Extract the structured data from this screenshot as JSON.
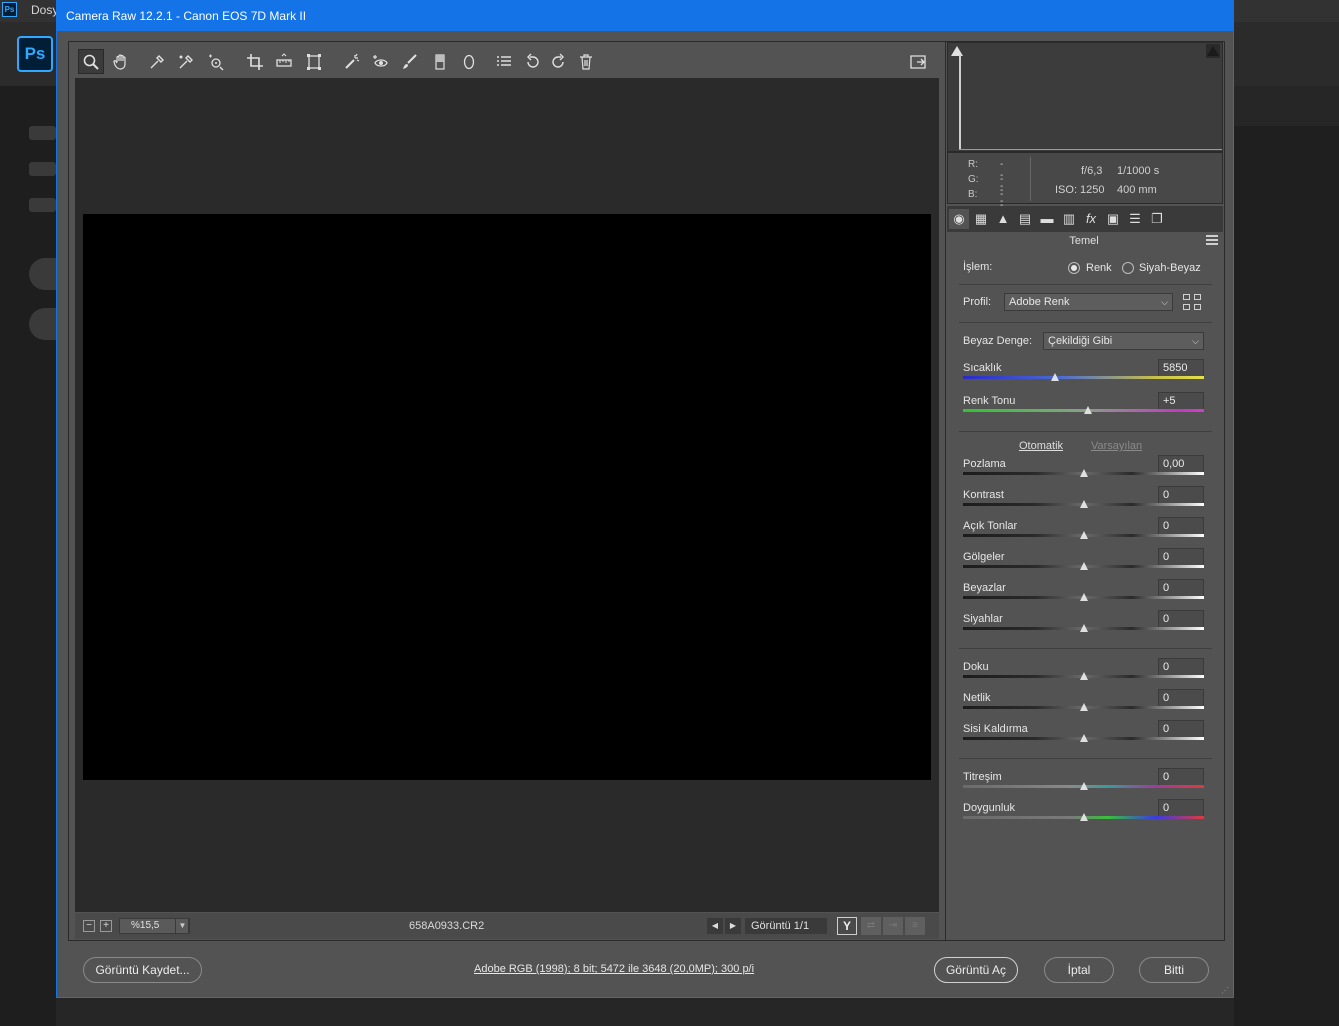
{
  "photoshop": {
    "logo_small": "Ps",
    "menu_first": "Dosy",
    "logo_big": "Ps"
  },
  "dialog": {
    "title": "Camera Raw 12.2.1  -  Canon EOS 7D Mark II"
  },
  "toolbar": {
    "tools": [
      "zoom-tool",
      "hand-tool",
      "white-balance-tool",
      "color-sampler-tool",
      "targeted-adjustment-tool",
      "crop-tool",
      "straighten-tool",
      "transform-tool",
      "spot-removal-tool",
      "red-eye-tool",
      "adjustment-brush-tool",
      "graduated-filter-tool",
      "radial-filter-tool",
      "presets-list-tool",
      "rotate-left-tool",
      "rotate-right-tool",
      "delete-tool"
    ],
    "active_tool": "zoom-tool"
  },
  "status": {
    "zoom": "%15,5",
    "filename": "658A0933.CR2",
    "view_info": "Görüntü 1/1",
    "y_button": "Y"
  },
  "info": {
    "r_label": "R:",
    "g_label": "G:",
    "b_label": "B:",
    "r_value": "---",
    "g_value": "---",
    "b_value": "---",
    "aperture": "f/6,3",
    "shutter": "1/1000 s",
    "iso": "ISO: 1250",
    "focal": "400 mm"
  },
  "panel": {
    "title": "Temel",
    "treatment_label": "İşlem:",
    "treatment_color": "Renk",
    "treatment_bw": "Siyah-Beyaz",
    "treatment_selected": "color",
    "profile_label": "Profil:",
    "profile_value": "Adobe Renk",
    "wb_label": "Beyaz Denge:",
    "wb_value": "Çekildiği Gibi",
    "auto_link": "Otomatik",
    "default_link": "Varsayılan",
    "wb_sliders": [
      {
        "label": "Sıcaklık",
        "value": "5850",
        "position": 0.38
      },
      {
        "label": "Renk Tonu",
        "value": "+5",
        "position": 0.52
      }
    ],
    "tone_sliders": [
      {
        "label": "Pozlama",
        "value": "0,00",
        "position": 0.5
      },
      {
        "label": "Kontrast",
        "value": "0",
        "position": 0.5
      },
      {
        "label": "Açık Tonlar",
        "value": "0",
        "position": 0.5
      },
      {
        "label": "Gölgeler",
        "value": "0",
        "position": 0.5
      },
      {
        "label": "Beyazlar",
        "value": "0",
        "position": 0.5
      },
      {
        "label": "Siyahlar",
        "value": "0",
        "position": 0.5
      }
    ],
    "presence_sliders": [
      {
        "label": "Doku",
        "value": "0",
        "position": 0.5
      },
      {
        "label": "Netlik",
        "value": "0",
        "position": 0.5
      },
      {
        "label": "Sisi Kaldırma",
        "value": "0",
        "position": 0.5
      }
    ],
    "color_sliders": [
      {
        "label": "Titreşim",
        "value": "0",
        "position": 0.5
      },
      {
        "label": "Doygunluk",
        "value": "0",
        "position": 0.5
      }
    ]
  },
  "footer": {
    "save_label": "Görüntü Kaydet...",
    "workflow_link": "Adobe RGB (1998); 8 bit; 5472 ile 3648 (20,0MP); 300 p/i",
    "open_label": "Görüntü Aç",
    "cancel_label": "İptal",
    "done_label": "Bitti"
  },
  "colors": {
    "accent": "#1473e6",
    "panel": "#535353",
    "canvas": "#000000"
  }
}
